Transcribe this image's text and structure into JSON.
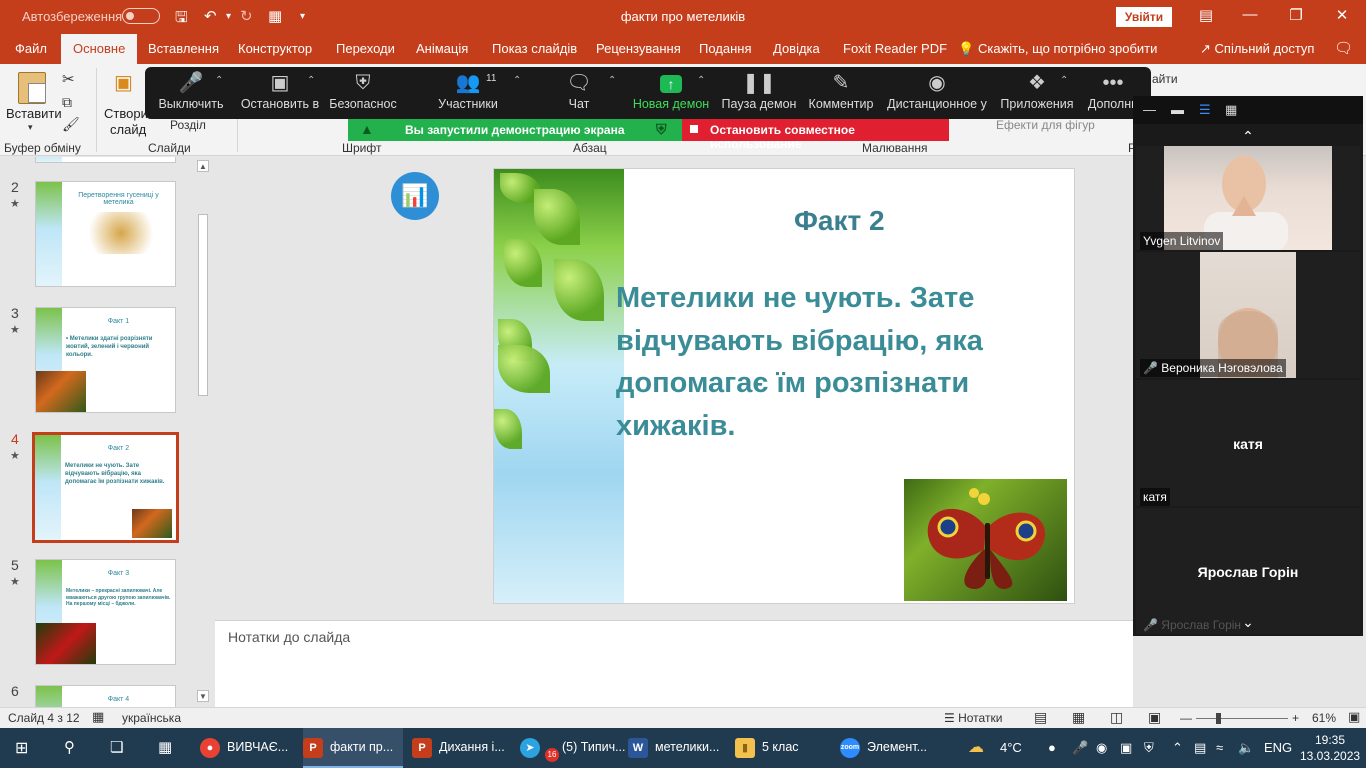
{
  "titlebar": {
    "autosave": "Автозбереження",
    "title": "факти про метеликів",
    "sign_in": "Увійти"
  },
  "tabs": [
    "Файл",
    "Основне",
    "Вставлення",
    "Конструктор",
    "Переходи",
    "Анімація",
    "Показ слайдів",
    "Рецензування",
    "Подання",
    "Довідка",
    "Foxit Reader PDF",
    "Скажіть, що потрібно зробити"
  ],
  "share": "Спільний доступ",
  "ribbon": {
    "paste": "Вставити",
    "clipboard_group": "Буфер обміну",
    "new_slide_line1": "Створити",
    "new_slide_line2": "слайд",
    "section": "Розділ",
    "slides_group": "Слайди",
    "font_group": "Шрифт",
    "paragraph_group": "Абзац",
    "drawing_group": "Малювання",
    "shape_effects": "Ефекти для фігур",
    "find_fragment": "айти",
    "editing_fragment": "Р"
  },
  "zoom_toolbar": {
    "mute": "Выключить",
    "video": "Остановить в",
    "security": "Безопаснос",
    "participants": "Участники",
    "participants_count": "11",
    "chat": "Чат",
    "new_share": "Новая демон",
    "pause_share": "Пауза демон",
    "annotate": "Комментир",
    "remote_control": "Дистанционное у",
    "apps": "Приложения",
    "more": "Дополни"
  },
  "share_banner": "Вы запустили демонстрацию экрана",
  "stop_banner": "Остановить совместное использование",
  "thumbnails": [
    {
      "num": "2",
      "title": "Перетворення гусениці у метелика",
      "body": ""
    },
    {
      "num": "3",
      "title": "Факт 1",
      "body": "• Метелики здатні розрізняти жовтий, зелений і червоний кольори."
    },
    {
      "num": "4",
      "title": "Факт 2",
      "body": "Метелики не чують. Зате відчувають вібрацію, яка допомагає їм розпізнати хижаків."
    },
    {
      "num": "5",
      "title": "Факт 3",
      "body": "Метелики – прекрасні запилювачі. Але вважаються другою групою запилювачів. На першому місці – бджоли."
    },
    {
      "num": "6",
      "title": "Факт 4",
      "body": ""
    }
  ],
  "slide": {
    "title": "Факт 2",
    "text": "Метелики не чують. Зате відчувають вібрацію, яка допомагає їм розпізнати хижаків."
  },
  "notes_placeholder": "Нотатки до слайда",
  "zoom_panel": {
    "participants": [
      {
        "name": "Yvgen Litvinov",
        "video": true,
        "muted": false
      },
      {
        "name": "Вероника Нэговэлова",
        "video": true,
        "muted": true
      },
      {
        "name": "катя",
        "display_name": "катя",
        "video": false,
        "muted": false
      },
      {
        "name": "Ярослав Горін",
        "display_name": "Ярослав Горін",
        "video": false,
        "muted": true
      }
    ]
  },
  "statusbar": {
    "slide_info": "Слайд 4 з 12",
    "language": "українська",
    "notes": "Нотатки",
    "zoom": "61%"
  },
  "taskbar": {
    "items": [
      {
        "label": "ВИВЧАЄ...",
        "icon": "chrome",
        "color": "#e94235"
      },
      {
        "label": "факти пр...",
        "icon": "P",
        "color": "#c43e1c"
      },
      {
        "label": "Дихання і...",
        "icon": "P",
        "color": "#c43e1c"
      },
      {
        "label": "(5) Типич...",
        "icon": "telegram",
        "color": "#2aa3e0"
      },
      {
        "label": "метелики...",
        "icon": "W",
        "color": "#2b579a"
      },
      {
        "label": "5 клас",
        "icon": "folder",
        "color": "#f2c14e"
      },
      {
        "label": "Элемент...",
        "icon": "zoom",
        "color": "#2d8cff"
      }
    ],
    "temperature": "4°C",
    "badge": "16",
    "language": "ENG",
    "time": "19:35",
    "date": "13.03.2023"
  }
}
